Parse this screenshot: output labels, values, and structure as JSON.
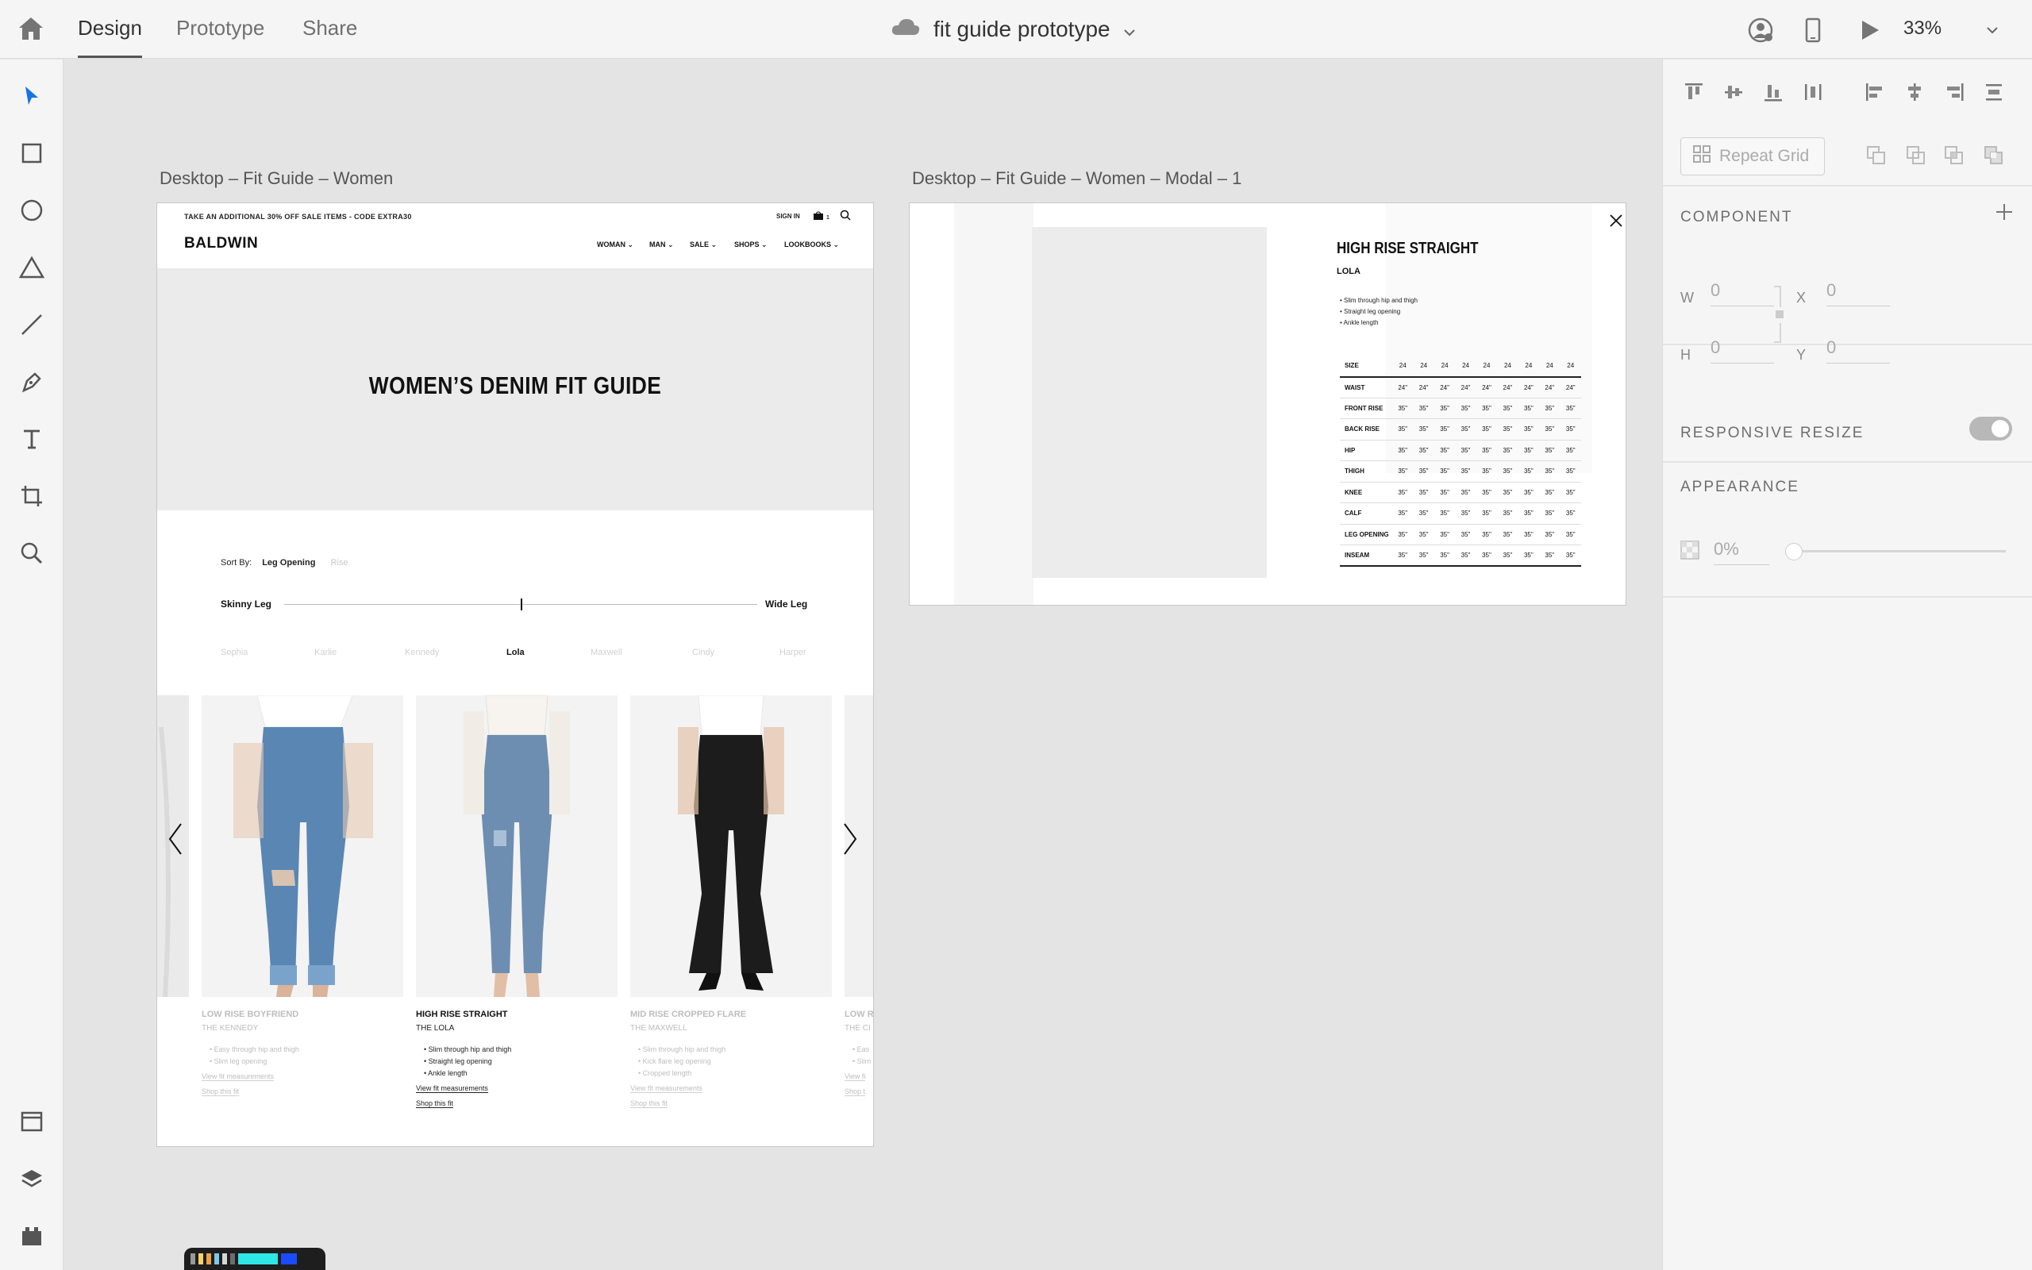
{
  "topbar": {
    "tabs": [
      "Design",
      "Prototype",
      "Share"
    ],
    "active_tab": "Design",
    "doc_title": "fit guide prototype",
    "zoom": "33%"
  },
  "icons": {
    "home": "home-icon",
    "cloud": "cloud-icon",
    "user": "user-icon",
    "device": "mobile-device-icon",
    "play": "play-icon"
  },
  "canvas": {
    "artboard1_label": "Desktop – Fit Guide – Women",
    "artboard2_label": "Desktop – Fit Guide – Women – Modal – 1"
  },
  "site": {
    "promo": "TAKE AN ADDITIONAL 30% OFF SALE ITEMS - CODE EXTRA30",
    "sign_in": "SIGN IN",
    "cart_count": "1",
    "brand": "BALDWIN",
    "nav": [
      "WOMAN",
      "MAN",
      "SALE",
      "SHOPS",
      "LOOKBOOKS"
    ],
    "hero_title": "WOMEN’S DENIM FIT GUIDE",
    "sort_by_label": "Sort By:",
    "sort_option_active": "Leg Opening",
    "sort_option_other": "Rise",
    "slider_left": "Skinny Leg",
    "slider_right": "Wide Leg",
    "slider_value": 0.5,
    "fits": [
      "Sophia",
      "Karlie",
      "Kennedy",
      "Lola",
      "Maxwell",
      "Cindy",
      "Harper"
    ],
    "selected_fit": "Lola",
    "products": [
      {
        "name": "LOW RISE BOYFRIEND",
        "sub": "THE KENNEDY",
        "features": [
          "Easy through hip and thigh",
          "Slim leg opening"
        ],
        "link1": "View fit measurements",
        "link2": "Shop this fit"
      },
      {
        "name": "HIGH RISE STRAIGHT",
        "sub": "THE LOLA",
        "features": [
          "Slim through hip and thigh",
          "Straight leg opening",
          "Ankle length"
        ],
        "link1": "View fit measurements",
        "link2": "Shop this fit"
      },
      {
        "name": "MID RISE CROPPED FLARE",
        "sub": "THE MAXWELL",
        "features": [
          "Slim through hip and thigh",
          "Kick flare leg opening",
          "Cropped length"
        ],
        "link1": "View fit measurements",
        "link2": "Shop this fit"
      },
      {
        "name": "LOW R",
        "sub": "THE CI",
        "features": [
          "Eas",
          "Slim"
        ],
        "link1": "View fi",
        "link2": "Shop t"
      }
    ]
  },
  "modal": {
    "title": "HIGH RISE STRAIGHT",
    "subtitle": "LOLA",
    "features": [
      "Slim through hip and thigh",
      "Straight leg opening",
      "Ankle length"
    ],
    "table": {
      "header": [
        "SIZE",
        "24",
        "24",
        "24",
        "24",
        "24",
        "24",
        "24",
        "24",
        "24"
      ],
      "rows": [
        [
          "WAIST",
          "24\"",
          "24\"",
          "24\"",
          "24\"",
          "24\"",
          "24\"",
          "24\"",
          "24\"",
          "24\""
        ],
        [
          "FRONT RISE",
          "35\"",
          "35\"",
          "35\"",
          "35\"",
          "35\"",
          "35\"",
          "35\"",
          "35\"",
          "35\""
        ],
        [
          "BACK RISE",
          "35\"",
          "35\"",
          "35\"",
          "35\"",
          "35\"",
          "35\"",
          "35\"",
          "35\"",
          "35\""
        ],
        [
          "HIP",
          "35\"",
          "35\"",
          "35\"",
          "35\"",
          "35\"",
          "35\"",
          "35\"",
          "35\"",
          "35\""
        ],
        [
          "THIGH",
          "35\"",
          "35\"",
          "35\"",
          "35\"",
          "35\"",
          "35\"",
          "35\"",
          "35\"",
          "35\""
        ],
        [
          "KNEE",
          "35\"",
          "35\"",
          "35\"",
          "35\"",
          "35\"",
          "35\"",
          "35\"",
          "35\"",
          "35\""
        ],
        [
          "CALF",
          "35\"",
          "35\"",
          "35\"",
          "35\"",
          "35\"",
          "35\"",
          "35\"",
          "35\"",
          "35\""
        ],
        [
          "LEG OPENING",
          "35\"",
          "35\"",
          "35\"",
          "35\"",
          "35\"",
          "35\"",
          "35\"",
          "35\"",
          "35\""
        ],
        [
          "INSEAM",
          "35\"",
          "35\"",
          "35\"",
          "35\"",
          "35\"",
          "35\"",
          "35\"",
          "35\"",
          "35\""
        ]
      ]
    }
  },
  "panel": {
    "repeat_grid": "Repeat Grid",
    "component_title": "COMPONENT",
    "w_label": "W",
    "w_value": "0",
    "h_label": "H",
    "h_value": "0",
    "x_label": "X",
    "x_value": "0",
    "y_label": "Y",
    "y_value": "0",
    "responsive_title": "RESPONSIVE RESIZE",
    "responsive_on": true,
    "appearance_title": "APPEARANCE",
    "opacity": "0%"
  },
  "colors": {
    "accent": "#1473e6",
    "chrome": "#f5f5f5",
    "canvas": "#e4e4e4"
  }
}
